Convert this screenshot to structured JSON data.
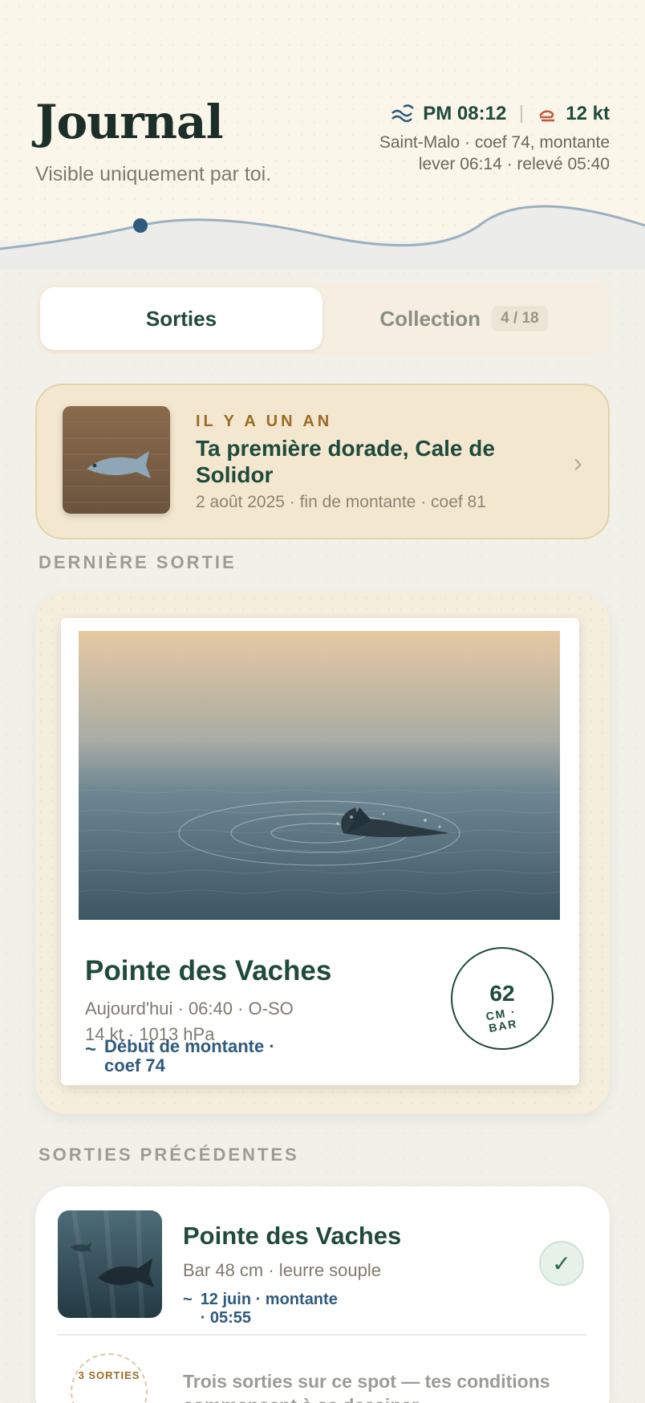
{
  "header": {
    "title": "Journal",
    "subtitle": "Visible uniquement par toi.",
    "high_tide": "PM 08:12",
    "wind": "12 kt",
    "location_line": "Saint-Malo · coef 74, montante",
    "times_line": "lever 06:14 · relevé 05:40"
  },
  "tabs": [
    {
      "label": "Sorties",
      "active": true
    },
    {
      "label": "Collection",
      "badge": "4 / 18",
      "active": false
    }
  ],
  "memory": {
    "kicker": "IL Y A UN AN",
    "title": "Ta première dorade, Cale de Solidor",
    "meta": "2 août 2025 · fin de montante · coef 81"
  },
  "sections": {
    "last": "DERNIÈRE SORTIE",
    "previous": "SORTIES PRÉCÉDENTES"
  },
  "last_outing": {
    "spot": "Pointe des Vaches",
    "line1": "Aujourd'hui · 06:40 · O-SO",
    "line2": "14 kt · 1013 hPa",
    "tide": "Début de montante · coef 74",
    "size_value": "62",
    "size_unit": "CM · BAR"
  },
  "previous_outings": [
    {
      "spot": "Pointe des Vaches",
      "meta": "Bar 48 cm · leurre souple",
      "tide": "12 juin · montante · 05:55"
    }
  ],
  "sessions_stamp": "3 SORTIES",
  "teaser": "Trois sorties sur ce spot — tes conditions commencent à se dessiner.",
  "colors": {
    "accent_green": "#1f4a3c",
    "tide_blue": "#2e5a7e",
    "kicker_amber": "#9a6b27"
  },
  "icons": {
    "tide": "waves-icon",
    "wind": "wind-icon",
    "chevron": "chevron-right-icon",
    "check": "check-icon"
  }
}
